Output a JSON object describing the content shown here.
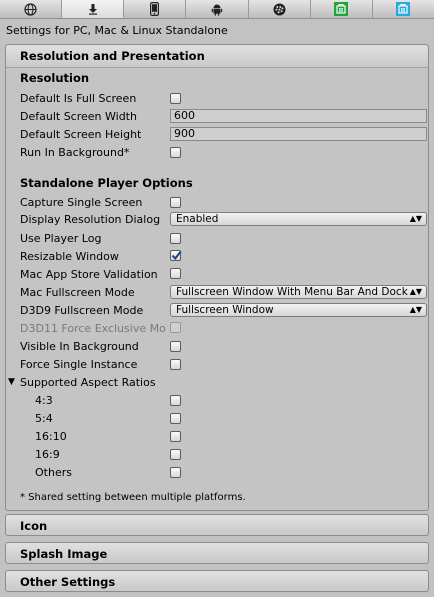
{
  "platform_tabs": [
    {
      "icon": "globe-icon"
    },
    {
      "icon": "download-icon"
    },
    {
      "icon": "iphone-icon"
    },
    {
      "icon": "android-icon"
    },
    {
      "icon": "blackberry-icon"
    },
    {
      "icon": "windows-store-green-icon"
    },
    {
      "icon": "windows-store-blue-icon"
    }
  ],
  "settings_title": "Settings for PC, Mac & Linux Standalone",
  "resolution_presentation": {
    "header": "Resolution and Presentation",
    "resolution_header": "Resolution",
    "default_full_screen": {
      "label": "Default Is Full Screen",
      "checked": false
    },
    "default_width": {
      "label": "Default Screen Width",
      "value": "600"
    },
    "default_height": {
      "label": "Default Screen Height",
      "value": "900"
    },
    "run_in_background": {
      "label": "Run In Background*",
      "checked": false
    },
    "standalone_header": "Standalone Player Options",
    "capture_single_screen": {
      "label": "Capture Single Screen",
      "checked": false
    },
    "display_resolution_dialog": {
      "label": "Display Resolution Dialog",
      "value": "Enabled"
    },
    "use_player_log": {
      "label": "Use Player Log",
      "checked": false
    },
    "resizable_window": {
      "label": "Resizable Window",
      "checked": true
    },
    "mac_app_store_validation": {
      "label": "Mac App Store Validation",
      "checked": false
    },
    "mac_fullscreen_mode": {
      "label": "Mac Fullscreen Mode",
      "value": "Fullscreen Window With Menu Bar And Dock"
    },
    "d3d9_fullscreen_mode": {
      "label": "D3D9 Fullscreen Mode",
      "value": "Fullscreen Window"
    },
    "d3d11_force_exclusive": {
      "label": "D3D11 Force Exclusive Mo",
      "checked": false
    },
    "visible_in_background": {
      "label": "Visible In Background",
      "checked": false
    },
    "force_single_instance": {
      "label": "Force Single Instance",
      "checked": false
    },
    "supported_aspect_ratios": {
      "label": "Supported Aspect Ratios",
      "items": [
        {
          "label": "4:3",
          "checked": false
        },
        {
          "label": "5:4",
          "checked": false
        },
        {
          "label": "16:10",
          "checked": false
        },
        {
          "label": "16:9",
          "checked": false
        },
        {
          "label": "Others",
          "checked": false
        }
      ]
    },
    "shared_note": "* Shared setting between multiple platforms."
  },
  "collapsed_sections": [
    "Icon",
    "Splash Image",
    "Other Settings"
  ]
}
